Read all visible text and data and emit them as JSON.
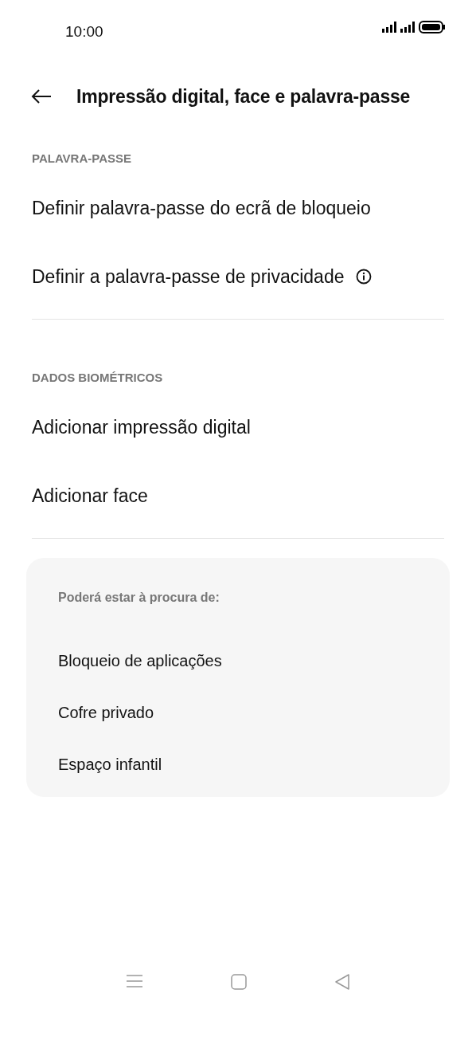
{
  "status_bar": {
    "time": "10:00"
  },
  "header": {
    "title": "Impressão digital, face e palavra-passe"
  },
  "sections": [
    {
      "heading": "PALAVRA-PASSE",
      "items": [
        {
          "label": "Definir palavra-passe do ecrã de bloqueio",
          "info": false
        },
        {
          "label": "Definir a palavra-passe de privacidade",
          "info": true
        }
      ]
    },
    {
      "heading": "DADOS BIOMÉTRICOS",
      "items": [
        {
          "label": "Adicionar impressão digital",
          "info": false
        },
        {
          "label": "Adicionar face",
          "info": false
        }
      ]
    }
  ],
  "suggestions": {
    "title": "Poderá estar à procura de:",
    "items": [
      "Bloqueio de aplicações",
      "Cofre privado",
      "Espaço infantil"
    ]
  }
}
